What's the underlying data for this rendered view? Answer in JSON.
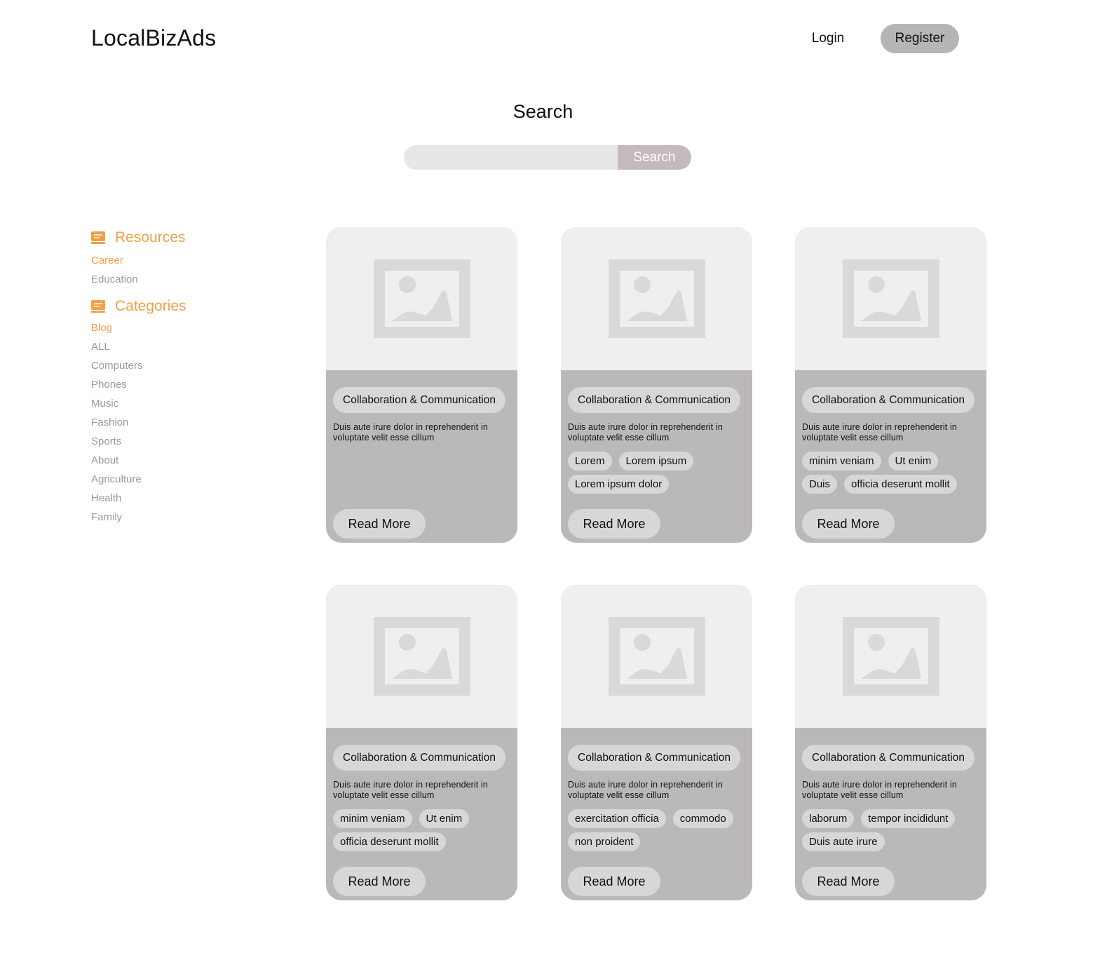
{
  "header": {
    "logo": "LocalBizAds",
    "login_label": "Login",
    "register_label": "Register"
  },
  "search": {
    "title": "Search",
    "placeholder": "",
    "value": "",
    "button_label": "Search"
  },
  "sidebar": {
    "resources": {
      "title": "Resources",
      "icon": "book-icon",
      "items": [
        "Career",
        "Education"
      ],
      "active": "Career"
    },
    "categories": {
      "title": "Categories",
      "icon": "book-icon",
      "items": [
        "Blog",
        "ALL",
        "Computers",
        "Phones",
        "Music",
        "Fashion",
        "Sports",
        "About",
        "Agriculture",
        "Health",
        "Family"
      ],
      "active": "Blog"
    }
  },
  "colors": {
    "accent": "#f0a04a",
    "card_bg": "#bbb8b8",
    "image_bg": "#efefef",
    "pill_bg": "#d8d6d6",
    "search_button": "#c4babb",
    "register_button": "#b5b5b5"
  },
  "cards": [
    {
      "title": "Collaboration & Communication",
      "description": "Duis aute irure dolor in reprehenderit in voluptate velit esse cillum",
      "tags": [],
      "read_more": "Read More"
    },
    {
      "title": "Collaboration & Communication",
      "description": "Duis aute irure dolor in reprehenderit in voluptate velit esse cillum",
      "tags": [
        "Lorem",
        "Lorem ipsum",
        "Lorem ipsum dolor"
      ],
      "read_more": "Read More"
    },
    {
      "title": "Collaboration & Communication",
      "description": "Duis aute irure dolor in reprehenderit in voluptate velit esse cillum",
      "tags": [
        "minim veniam",
        "Ut enim",
        "Duis",
        "officia deserunt mollit"
      ],
      "read_more": "Read More"
    },
    {
      "title": "Collaboration & Communication",
      "description": "Duis aute irure dolor in reprehenderit in voluptate velit esse cillum",
      "tags": [
        "minim veniam",
        "Ut enim",
        "officia deserunt mollit"
      ],
      "read_more": "Read More"
    },
    {
      "title": "Collaboration & Communication",
      "description": "Duis aute irure dolor in reprehenderit in voluptate velit esse cillum",
      "tags": [
        "exercitation officia",
        "commodo",
        "non proident"
      ],
      "read_more": "Read More"
    },
    {
      "title": "Collaboration & Communication",
      "description": "Duis aute irure dolor in reprehenderit in voluptate velit esse cillum",
      "tags": [
        "laborum",
        "tempor incididunt",
        "Duis aute irure"
      ],
      "read_more": "Read More"
    }
  ]
}
